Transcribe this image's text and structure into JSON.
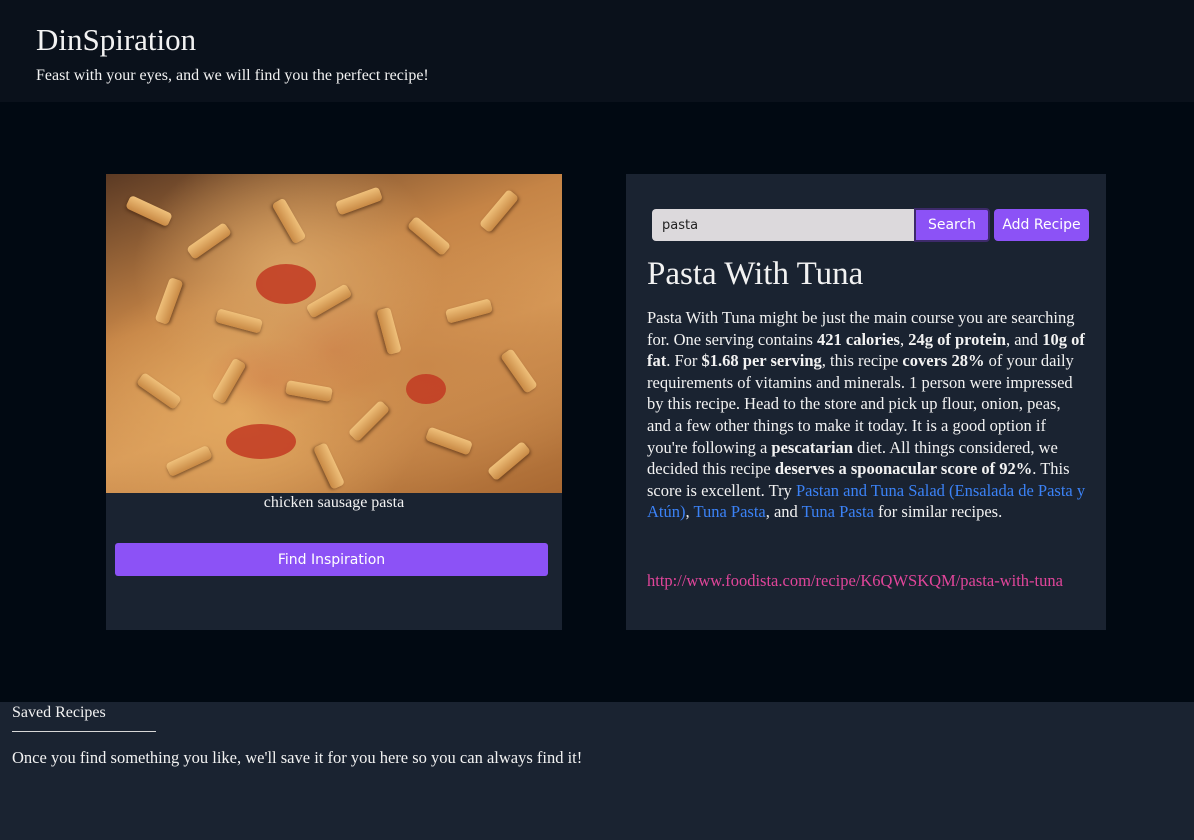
{
  "header": {
    "title": "DinSpiration",
    "tagline": "Feast with your eyes, and we will find you the perfect recipe!"
  },
  "inspiration": {
    "image_caption": "chicken sausage pasta",
    "find_button": "Find Inspiration"
  },
  "search": {
    "value": "pasta",
    "search_button": "Search",
    "add_button": "Add Recipe"
  },
  "recipe": {
    "title": "Pasta With Tuna",
    "summary": {
      "t1": "Pasta With Tuna might be just the main course you are searching for. One serving contains ",
      "b_calories": "421 calories",
      "t2": ", ",
      "b_protein": "24g of protein",
      "t3": ", and ",
      "b_fat": "10g of fat",
      "t4": ". For ",
      "b_price": "$1.68 per serving",
      "t5": ", this recipe ",
      "b_covers": "covers 28%",
      "t6": " of your daily requirements of vitamins and minerals. 1 person were impressed by this recipe. Head to the store and pick up flour, onion, peas, and a few other things to make it today. It is a good option if you're following a ",
      "b_diet": "pescatarian",
      "t7": " diet. All things considered, we decided this recipe ",
      "b_score": "deserves a spoonacular score of 92%",
      "t8": ". This score is excellent. Try ",
      "link1": "Pastan and Tuna Salad (Ensalada de Pasta y Atún)",
      "t9": ", ",
      "link2": "Tuna Pasta",
      "t10": ", and ",
      "link3": "Tuna Pasta",
      "t11": " for similar recipes."
    },
    "source_url": "http://www.foodista.com/recipe/K6QWSKQM/pasta-with-tuna"
  },
  "saved": {
    "title": "Saved Recipes",
    "empty_message": "Once you find something you like, we'll save it for you here so you can always find it!"
  },
  "colors": {
    "accent": "#8c52f6",
    "link": "#3b82f6",
    "source_link": "#e0459a",
    "card_bg": "#1a2331",
    "page_bg": "#010912"
  }
}
